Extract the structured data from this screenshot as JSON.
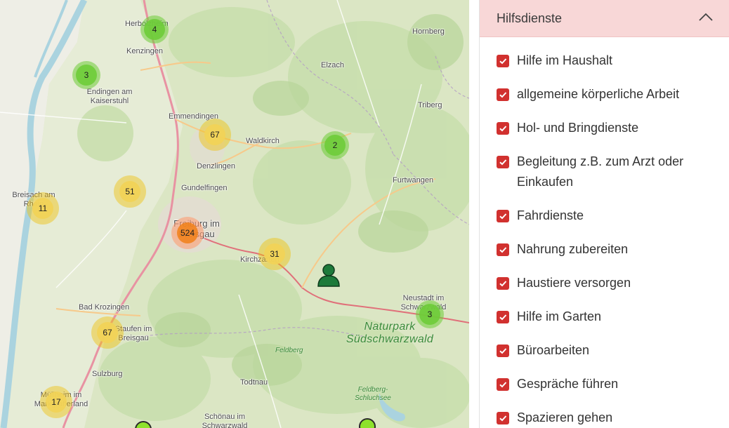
{
  "map": {
    "places": [
      {
        "name": "Herbolzheim"
      },
      {
        "name": "Kenzingen"
      },
      {
        "name": "Endingen am Kaiserstuhl"
      },
      {
        "name": "Elzach"
      },
      {
        "name": "Hornberg"
      },
      {
        "name": "Emmendingen"
      },
      {
        "name": "Waldkirch"
      },
      {
        "name": "Triberg"
      },
      {
        "name": "Denzlingen"
      },
      {
        "name": "Gundelfingen"
      },
      {
        "name": "Breisach am Rhein"
      },
      {
        "name": "Furtwangen"
      },
      {
        "name": "Freiburg im Breisgau"
      },
      {
        "name": "Kirchzarten"
      },
      {
        "name": "Bad Krozingen"
      },
      {
        "name": "Staufen im Breisgau"
      },
      {
        "name": "Neustadt im Schwarzwald"
      },
      {
        "name": "Sulzburg"
      },
      {
        "name": "Todtnau"
      },
      {
        "name": "Müllheim im Markgräflerland"
      },
      {
        "name": "Schönau im Schwarzwald"
      },
      {
        "name": "Feldberg"
      },
      {
        "name": "Feldberg-Schluchsee"
      }
    ],
    "park_label": "Naturpark Südschwarzwald",
    "feldberg_label": "Feldberg",
    "schluchsee_label": "Feldberg-\nSchluchsee",
    "clusters": [
      {
        "count": "4",
        "tier": "green"
      },
      {
        "count": "3",
        "tier": "green"
      },
      {
        "count": "67",
        "tier": "yellow"
      },
      {
        "count": "2",
        "tier": "green"
      },
      {
        "count": "51",
        "tier": "yellow"
      },
      {
        "count": "11",
        "tier": "yellow"
      },
      {
        "count": "524",
        "tier": "orange"
      },
      {
        "count": "31",
        "tier": "yellow"
      },
      {
        "count": "3",
        "tier": "green"
      },
      {
        "count": "67",
        "tier": "yellow"
      },
      {
        "count": "17",
        "tier": "yellow"
      }
    ],
    "colors": {
      "cluster_green": "#6ecc39",
      "cluster_yellow": "#f1d357",
      "cluster_orange": "#f18017",
      "person_marker": "#1d7a3a"
    }
  },
  "panel": {
    "header_title": "Hilfsdienste",
    "header_icon": "chevron-up-icon",
    "header_bg": "#f8d7d7",
    "checkbox_color": "#d1312f",
    "items": [
      {
        "label": "Hilfe im Haushalt",
        "checked": true
      },
      {
        "label": "allgemeine körperliche Arbeit",
        "checked": true
      },
      {
        "label": "Hol- und Bringdienste",
        "checked": true
      },
      {
        "label": "Begleitung z.B. zum Arzt oder Einkaufen",
        "checked": true
      },
      {
        "label": "Fahrdienste",
        "checked": true
      },
      {
        "label": "Nahrung zubereiten",
        "checked": true
      },
      {
        "label": "Haustiere versorgen",
        "checked": true
      },
      {
        "label": "Hilfe im Garten",
        "checked": true
      },
      {
        "label": "Büroarbeiten",
        "checked": true
      },
      {
        "label": "Gespräche führen",
        "checked": true
      },
      {
        "label": "Spazieren gehen",
        "checked": true
      }
    ]
  }
}
